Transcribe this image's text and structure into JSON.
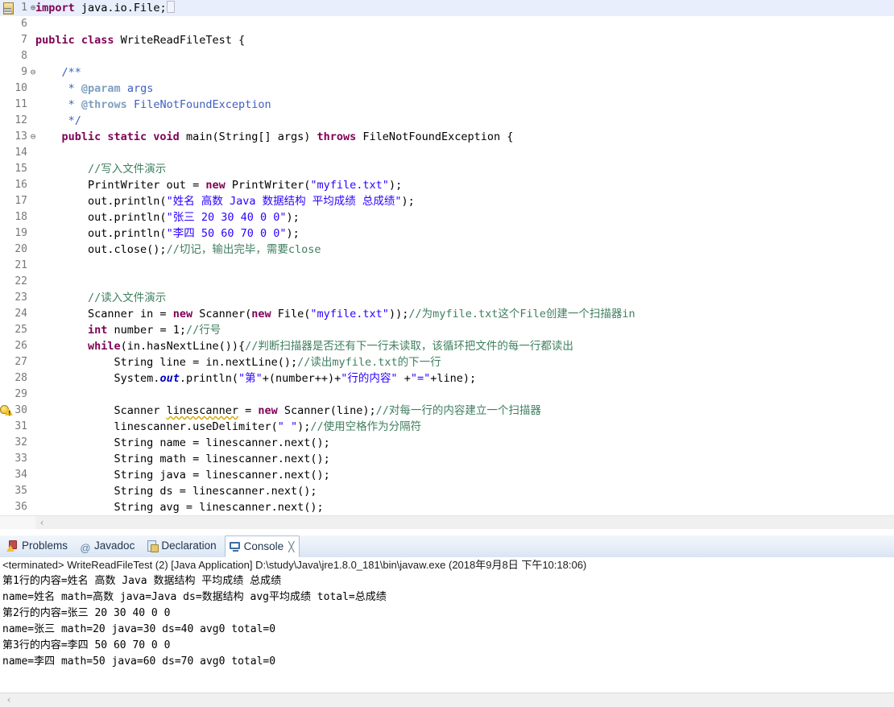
{
  "editor": {
    "name": "java-code-editor",
    "language": "Java",
    "current_line": 1,
    "colors": {
      "keyword": "#7f0055",
      "string": "#2a00ff",
      "comment": "#3f7f5f",
      "javadoc": "#3f5fbf",
      "javadoc_tag": "#7f9fbf",
      "static_field": "#0000c0",
      "line_number": "#787878",
      "current_line_highlight": "#e8eefb"
    },
    "lines": [
      {
        "num": "1",
        "fold": "⊕",
        "marker": "bookmark-icon",
        "current": true,
        "tokens": [
          {
            "t": "kw",
            "v": "import"
          },
          {
            "t": "plain",
            "v": " java.io.File;"
          },
          {
            "t": "caret",
            "v": ""
          }
        ]
      },
      {
        "num": "6",
        "fold": "",
        "marker": "",
        "tokens": []
      },
      {
        "num": "7",
        "fold": "",
        "marker": "",
        "tokens": [
          {
            "t": "kw",
            "v": "public class"
          },
          {
            "t": "plain",
            "v": " WriteReadFileTest {"
          }
        ]
      },
      {
        "num": "8",
        "fold": "",
        "marker": "",
        "tokens": []
      },
      {
        "num": "9",
        "fold": "⊖",
        "marker": "",
        "tokens": [
          {
            "t": "jdoc",
            "v": "    /**"
          }
        ]
      },
      {
        "num": "10",
        "fold": "",
        "marker": "",
        "tokens": [
          {
            "t": "jdoc",
            "v": "     * "
          },
          {
            "t": "jtag",
            "v": "@param"
          },
          {
            "t": "jdoc",
            "v": " args"
          }
        ]
      },
      {
        "num": "11",
        "fold": "",
        "marker": "",
        "tokens": [
          {
            "t": "jdoc",
            "v": "     * "
          },
          {
            "t": "jtag",
            "v": "@throws"
          },
          {
            "t": "jdoc",
            "v": " FileNotFoundException"
          }
        ]
      },
      {
        "num": "12",
        "fold": "",
        "marker": "",
        "tokens": [
          {
            "t": "jdoc",
            "v": "     */"
          }
        ]
      },
      {
        "num": "13",
        "fold": "⊖",
        "marker": "",
        "tokens": [
          {
            "t": "plain",
            "v": "    "
          },
          {
            "t": "kw",
            "v": "public static void"
          },
          {
            "t": "plain",
            "v": " main(String[] args) "
          },
          {
            "t": "kw",
            "v": "throws"
          },
          {
            "t": "plain",
            "v": " FileNotFoundException {"
          }
        ]
      },
      {
        "num": "14",
        "fold": "",
        "marker": "",
        "tokens": []
      },
      {
        "num": "15",
        "fold": "",
        "marker": "",
        "tokens": [
          {
            "t": "cmt",
            "v": "        //写入文件演示"
          }
        ]
      },
      {
        "num": "16",
        "fold": "",
        "marker": "",
        "tokens": [
          {
            "t": "plain",
            "v": "        PrintWriter out = "
          },
          {
            "t": "kw",
            "v": "new"
          },
          {
            "t": "plain",
            "v": " PrintWriter("
          },
          {
            "t": "str",
            "v": "\"myfile.txt\""
          },
          {
            "t": "plain",
            "v": ");"
          }
        ]
      },
      {
        "num": "17",
        "fold": "",
        "marker": "",
        "tokens": [
          {
            "t": "plain",
            "v": "        out.println("
          },
          {
            "t": "str",
            "v": "\"姓名 高数 Java 数据结构 平均成绩 总成绩\""
          },
          {
            "t": "plain",
            "v": ");"
          }
        ]
      },
      {
        "num": "18",
        "fold": "",
        "marker": "",
        "tokens": [
          {
            "t": "plain",
            "v": "        out.println("
          },
          {
            "t": "str",
            "v": "\"张三 20 30 40 0 0\""
          },
          {
            "t": "plain",
            "v": ");"
          }
        ]
      },
      {
        "num": "19",
        "fold": "",
        "marker": "",
        "tokens": [
          {
            "t": "plain",
            "v": "        out.println("
          },
          {
            "t": "str",
            "v": "\"李四 50 60 70 0 0\""
          },
          {
            "t": "plain",
            "v": ");"
          }
        ]
      },
      {
        "num": "20",
        "fold": "",
        "marker": "",
        "tokens": [
          {
            "t": "plain",
            "v": "        out.close();"
          },
          {
            "t": "cmt",
            "v": "//切记，输出完毕，需要close"
          }
        ]
      },
      {
        "num": "21",
        "fold": "",
        "marker": "",
        "tokens": []
      },
      {
        "num": "22",
        "fold": "",
        "marker": "",
        "tokens": []
      },
      {
        "num": "23",
        "fold": "",
        "marker": "",
        "tokens": [
          {
            "t": "cmt",
            "v": "        //读入文件演示"
          }
        ]
      },
      {
        "num": "24",
        "fold": "",
        "marker": "",
        "tokens": [
          {
            "t": "plain",
            "v": "        Scanner in = "
          },
          {
            "t": "kw",
            "v": "new"
          },
          {
            "t": "plain",
            "v": " Scanner("
          },
          {
            "t": "kw",
            "v": "new"
          },
          {
            "t": "plain",
            "v": " File("
          },
          {
            "t": "str",
            "v": "\"myfile.txt\""
          },
          {
            "t": "plain",
            "v": "));"
          },
          {
            "t": "cmt",
            "v": "//为myfile.txt这个File创建一个扫描器in"
          }
        ]
      },
      {
        "num": "25",
        "fold": "",
        "marker": "",
        "tokens": [
          {
            "t": "plain",
            "v": "        "
          },
          {
            "t": "kw",
            "v": "int"
          },
          {
            "t": "plain",
            "v": " number = 1;"
          },
          {
            "t": "cmt",
            "v": "//行号"
          }
        ]
      },
      {
        "num": "26",
        "fold": "",
        "marker": "",
        "tokens": [
          {
            "t": "plain",
            "v": "        "
          },
          {
            "t": "kw",
            "v": "while"
          },
          {
            "t": "plain",
            "v": "(in.hasNextLine()){"
          },
          {
            "t": "cmt",
            "v": "//判断扫描器是否还有下一行未读取，该循环把文件的每一行都读出"
          }
        ]
      },
      {
        "num": "27",
        "fold": "",
        "marker": "",
        "tokens": [
          {
            "t": "plain",
            "v": "            String line = in.nextLine();"
          },
          {
            "t": "cmt",
            "v": "//读出myfile.txt的下一行"
          }
        ]
      },
      {
        "num": "28",
        "fold": "",
        "marker": "",
        "tokens": [
          {
            "t": "plain",
            "v": "            System."
          },
          {
            "t": "fld",
            "v": "out"
          },
          {
            "t": "plain",
            "v": ".println("
          },
          {
            "t": "str",
            "v": "\"第\""
          },
          {
            "t": "plain",
            "v": "+(number++)+"
          },
          {
            "t": "str",
            "v": "\"行的内容\""
          },
          {
            "t": "plain",
            "v": " +"
          },
          {
            "t": "str",
            "v": "\"=\""
          },
          {
            "t": "plain",
            "v": "+line);"
          }
        ]
      },
      {
        "num": "29",
        "fold": "",
        "marker": "",
        "tokens": []
      },
      {
        "num": "30",
        "fold": "",
        "marker": "warning-bulb-icon",
        "tokens": [
          {
            "t": "plain",
            "v": "            Scanner "
          },
          {
            "t": "warnu",
            "v": "linescanner"
          },
          {
            "t": "plain",
            "v": " = "
          },
          {
            "t": "kw",
            "v": "new"
          },
          {
            "t": "plain",
            "v": " Scanner(line);"
          },
          {
            "t": "cmt",
            "v": "//对每一行的内容建立一个扫描器"
          }
        ]
      },
      {
        "num": "31",
        "fold": "",
        "marker": "",
        "tokens": [
          {
            "t": "plain",
            "v": "            linescanner.useDelimiter("
          },
          {
            "t": "str",
            "v": "\" \""
          },
          {
            "t": "plain",
            "v": ");"
          },
          {
            "t": "cmt",
            "v": "//使用空格作为分隔符"
          }
        ]
      },
      {
        "num": "32",
        "fold": "",
        "marker": "",
        "tokens": [
          {
            "t": "plain",
            "v": "            String name = linescanner.next();"
          }
        ]
      },
      {
        "num": "33",
        "fold": "",
        "marker": "",
        "tokens": [
          {
            "t": "plain",
            "v": "            String math = linescanner.next();"
          }
        ]
      },
      {
        "num": "34",
        "fold": "",
        "marker": "",
        "tokens": [
          {
            "t": "plain",
            "v": "            String java = linescanner.next();"
          }
        ]
      },
      {
        "num": "35",
        "fold": "",
        "marker": "",
        "tokens": [
          {
            "t": "plain",
            "v": "            String ds = linescanner.next();"
          }
        ]
      },
      {
        "num": "36",
        "fold": "",
        "marker": "",
        "tokens": [
          {
            "t": "plain",
            "v": "            String avg = linescanner.next();"
          }
        ]
      }
    ],
    "scroll_left_arrow": "‹"
  },
  "console_panel": {
    "tabs": [
      {
        "label": "Problems",
        "icon": "problems-icon",
        "active": false,
        "closeable": false
      },
      {
        "label": "Javadoc",
        "icon": "javadoc-icon",
        "active": false,
        "closeable": false
      },
      {
        "label": "Declaration",
        "icon": "declaration-icon",
        "active": false,
        "closeable": false
      },
      {
        "label": "Console",
        "icon": "console-icon",
        "active": true,
        "closeable": true
      }
    ],
    "close_glyph": "╳",
    "javadoc_glyph": "@",
    "launch_header": "<terminated> WriteReadFileTest (2) [Java Application] D:\\study\\Java\\jre1.8.0_181\\bin\\javaw.exe (2018年9月8日 下午10:18:06)",
    "output_lines": [
      "第1行的内容=姓名 高数 Java 数据结构 平均成绩 总成绩",
      "name=姓名 math=高数 java=Java ds=数据结构 avg平均成绩 total=总成绩",
      "第2行的内容=张三 20 30 40 0 0",
      "name=张三 math=20 java=30 ds=40 avg0 total=0",
      "第3行的内容=李四 50 60 70 0 0",
      "name=李四 math=50 java=60 ds=70 avg0 total=0"
    ],
    "scroll_left_arrow": "‹"
  }
}
